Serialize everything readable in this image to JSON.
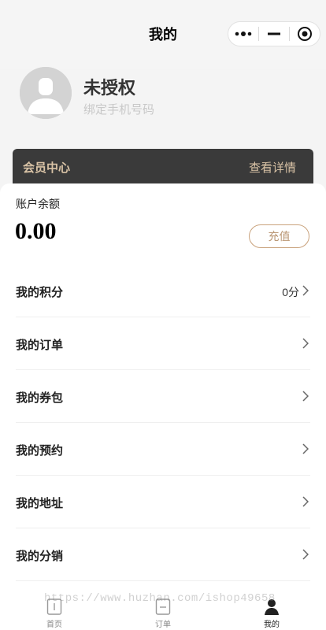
{
  "nav": {
    "title": "我的",
    "capsule_icons": [
      "more-dots-icon",
      "minimize-icon",
      "close-circle-icon"
    ]
  },
  "profile": {
    "nickname": "未授权",
    "bind_phone": "绑定手机号码",
    "avatar_icon": "default-avatar-icon"
  },
  "member": {
    "title": "会员中心",
    "detail": "查看详情"
  },
  "account": {
    "label": "账户余额",
    "balance": "0.00",
    "recharge_label": "充值"
  },
  "menu": [
    {
      "label": "我的积分",
      "value": "0分"
    },
    {
      "label": "我的订单",
      "value": ""
    },
    {
      "label": "我的券包",
      "value": ""
    },
    {
      "label": "我的预约",
      "value": ""
    },
    {
      "label": "我的地址",
      "value": ""
    },
    {
      "label": "我的分销",
      "value": ""
    }
  ],
  "tabbar": {
    "items": [
      {
        "label": "首页",
        "icon": "home-icon",
        "active": false
      },
      {
        "label": "订单",
        "icon": "order-icon",
        "active": false
      },
      {
        "label": "我的",
        "icon": "user-icon",
        "active": true
      }
    ]
  },
  "watermark": "https://www.huzhan.com/ishop49658",
  "colors": {
    "accent_gold": "#c9a27c",
    "member_bg": "#3a3a3a",
    "member_text": "#d9c3a6"
  }
}
